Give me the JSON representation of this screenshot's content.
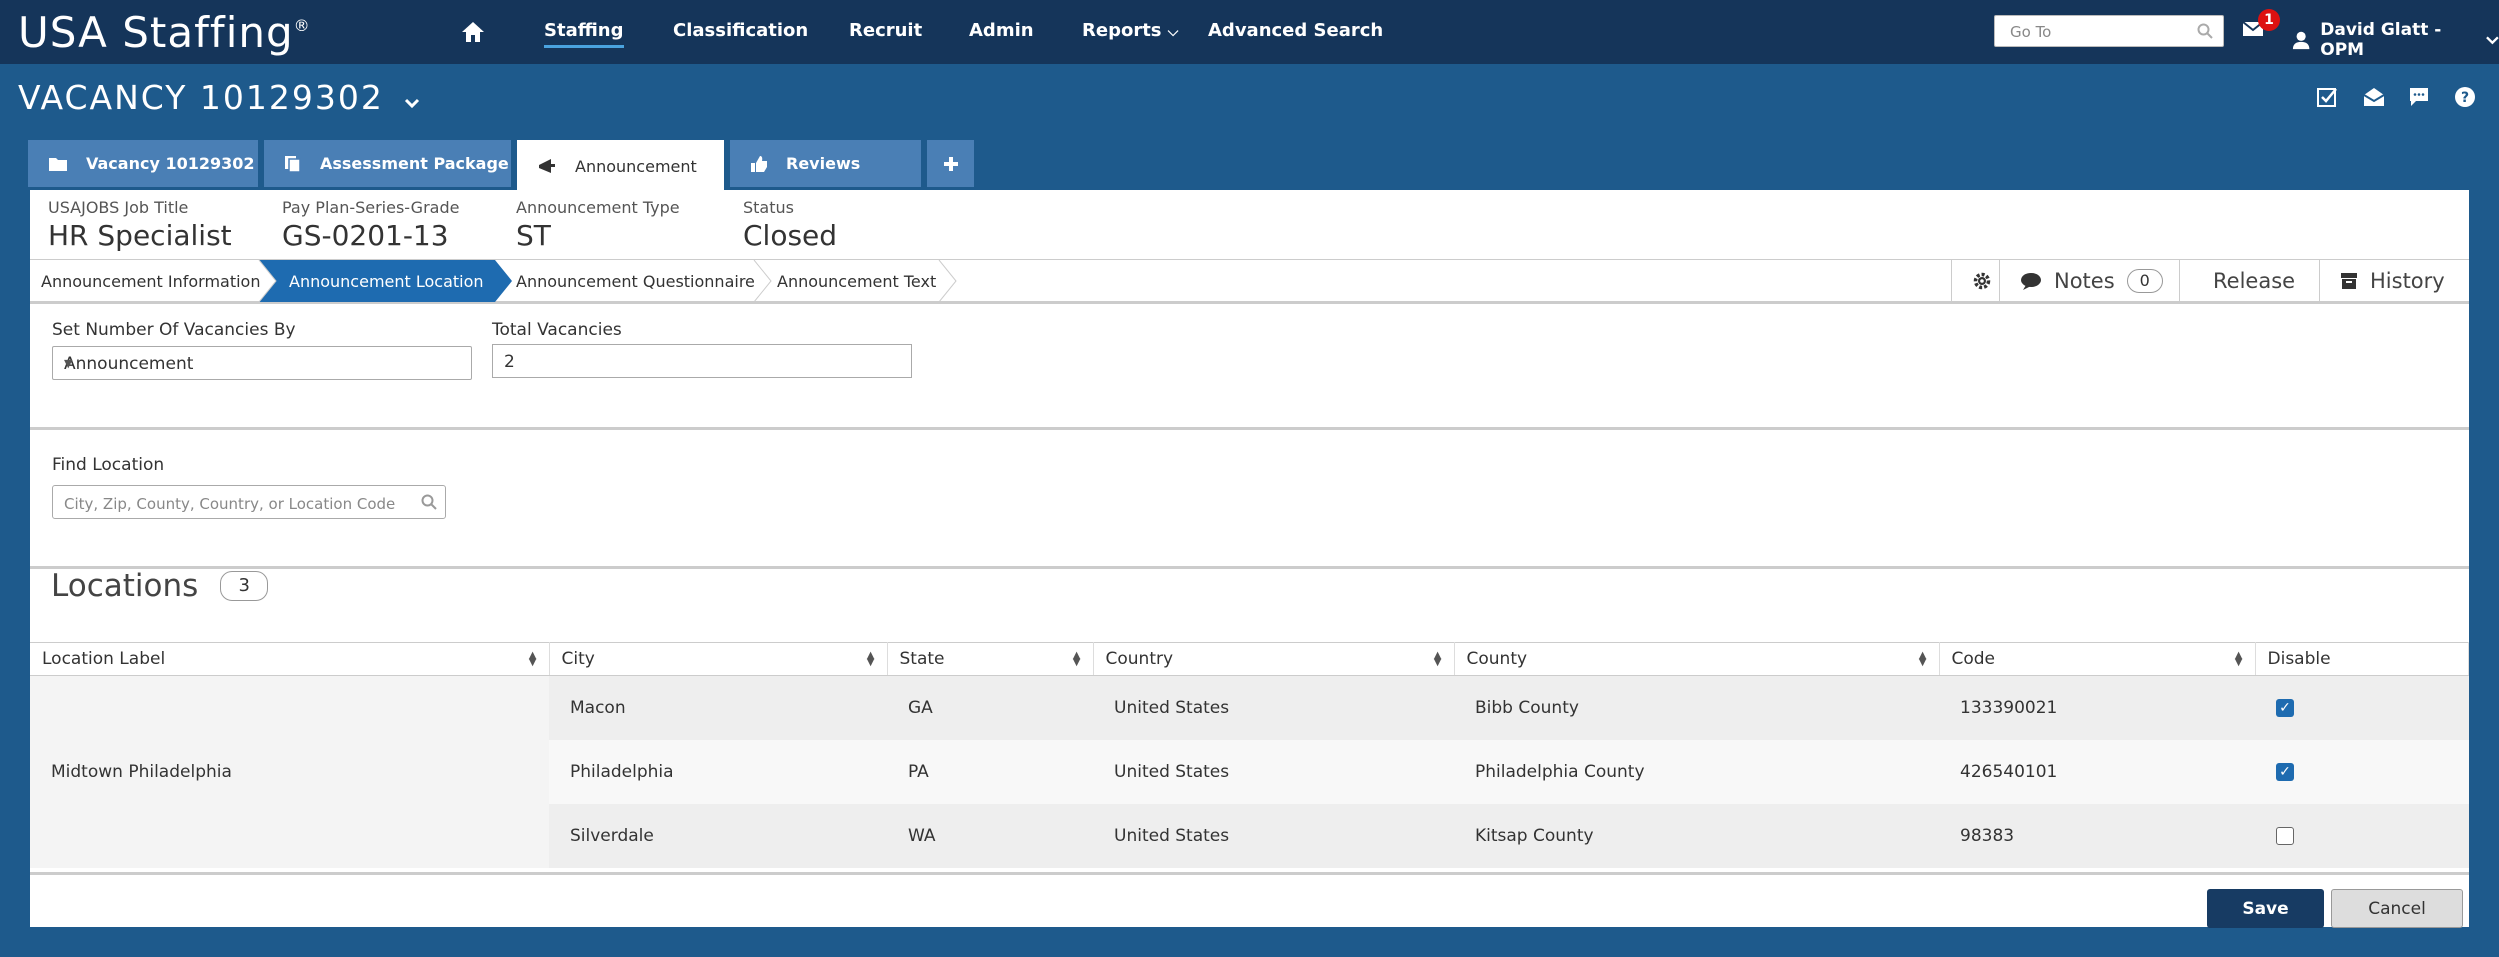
{
  "app": {
    "logo": "USA Staffing",
    "logo_mark": "®"
  },
  "nav": {
    "items": [
      "Staffing",
      "Classification",
      "Recruit",
      "Admin",
      "Reports",
      "Advanced Search"
    ],
    "goto_placeholder": "Go To",
    "mail_count": "1",
    "user": "David Glatt - OPM"
  },
  "vacancy": {
    "title": "VACANCY 10129302"
  },
  "tabs": [
    {
      "label": "Vacancy 10129302",
      "icon": "folder-icon"
    },
    {
      "label": "Assessment Package",
      "icon": "documents-icon"
    },
    {
      "label": "Announcement",
      "icon": "megaphone-icon"
    },
    {
      "label": "Reviews",
      "icon": "thumbs-up-icon"
    }
  ],
  "summary": {
    "job_title_label": "USAJOBS Job Title",
    "job_title": "HR Specialist",
    "grade_label": "Pay Plan-Series-Grade",
    "grade": "GS-0201-13",
    "type_label": "Announcement Type",
    "type": "ST",
    "status_label": "Status",
    "status": "Closed"
  },
  "steps": [
    "Announcement Information",
    "Announcement Location",
    "Announcement Questionnaire",
    "Announcement Text"
  ],
  "tools": {
    "notes": "Notes",
    "notes_count": "0",
    "release": "Release",
    "history": "History"
  },
  "form": {
    "vacancies_by_label": "Set Number Of Vacancies By",
    "vacancies_by_value": "Announcement",
    "total_label": "Total Vacancies",
    "total_value": "2",
    "find_label": "Find Location",
    "find_placeholder": "City, Zip, County, Country, or Location Code"
  },
  "locations": {
    "title": "Locations",
    "count": "3",
    "columns": [
      "Location Label",
      "City",
      "State",
      "Country",
      "County",
      "Code",
      "Disable"
    ],
    "group_label": "Midtown Philadelphia",
    "rows": [
      {
        "city": "Macon",
        "state": "GA",
        "country": "United States",
        "county": "Bibb County",
        "code": "133390021",
        "disabled": true
      },
      {
        "city": "Philadelphia",
        "state": "PA",
        "country": "United States",
        "county": "Philadelphia County",
        "code": "426540101",
        "disabled": true
      },
      {
        "city": "Silverdale",
        "state": "WA",
        "country": "United States",
        "county": "Kitsap County",
        "code": "98383",
        "disabled": false
      }
    ]
  },
  "buttons": {
    "save": "Save",
    "cancel": "Cancel"
  }
}
